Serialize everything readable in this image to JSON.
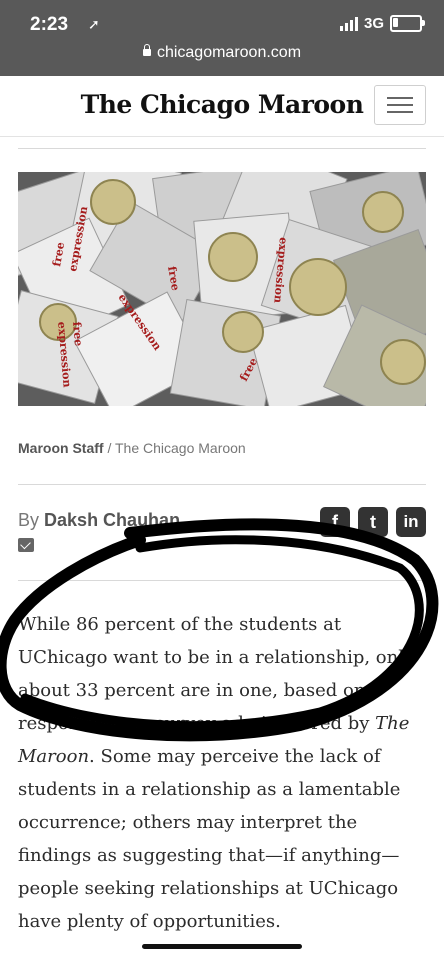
{
  "status": {
    "time": "2:23",
    "network": "3G"
  },
  "browser": {
    "url": "chicagomaroon.com"
  },
  "header": {
    "masthead": "The Chicago Maroon"
  },
  "photo": {
    "credit_name": "Maroon Staff",
    "credit_separator": " / ",
    "credit_source": "The Chicago Maroon",
    "packet_text": [
      "free",
      "expression",
      "free",
      "expression",
      "free",
      "expression",
      "free",
      "expression"
    ]
  },
  "byline": {
    "prefix": "By",
    "author": "Daksh Chauhan"
  },
  "social": {
    "facebook": "f",
    "twitter": "t",
    "linkedin": "in"
  },
  "article": {
    "text_1": "While 86 percent of the students at UChicago want to be in a relationship, only about 33 percent are in one, based on responses to a survey administered by ",
    "publication": "The Maroon",
    "text_2": ". Some may perceive the lack of students in a relationship as a lamentable occurrence; others may interpret the findings as suggesting that—if anything—people seeking relationships at UChicago have plenty of opportunities."
  },
  "colors": {
    "status_bg": "#595959",
    "text": "#2b2b2b",
    "muted": "#777777",
    "stamp_red": "#a51c1c"
  }
}
